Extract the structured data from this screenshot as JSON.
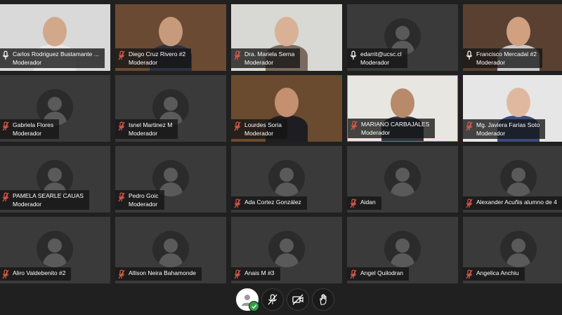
{
  "participants": [
    {
      "name": "Carlos Rodriguez Bustamante ...",
      "role": "Moderador",
      "mic": "on",
      "video": true,
      "bg": "#d9d9d9",
      "skin": "#d2a88a",
      "shirt": "#e8e8e8"
    },
    {
      "name": "Diego Cruz Rivero #2",
      "role": "Moderador",
      "mic": "muted",
      "video": true,
      "bg": "#6b4a33",
      "skin": "#c89a7c",
      "shirt": "#2d3140"
    },
    {
      "name": "Dra. Mariela Serna",
      "role": "Moderador",
      "mic": "muted",
      "video": true,
      "bg": "#d8d8d4",
      "skin": "#d9b196",
      "shirt": "#7b6a5f"
    },
    {
      "name": "edarrit@ucsc.cl",
      "role": "Moderador",
      "mic": "on",
      "video": false
    },
    {
      "name": "Francisco Mercadal #2",
      "role": "Moderador",
      "mic": "on",
      "video": true,
      "bg": "#5a4030",
      "skin": "#d0a080",
      "shirt": "#c9c9c9"
    },
    {
      "name": "Gabriela Flores",
      "role": "Moderador",
      "mic": "muted",
      "video": false
    },
    {
      "name": "Isnel Martinez M",
      "role": "Moderador",
      "mic": "muted",
      "video": false
    },
    {
      "name": "Lourdes Soria",
      "role": "Moderador",
      "mic": "muted",
      "video": true,
      "bg": "#6a4b2f",
      "skin": "#c49070",
      "shirt": "#1e1e22"
    },
    {
      "name": "MARIANO CARBAJALES",
      "role": "Moderador",
      "mic": "muted",
      "video": true,
      "bg": "#e8e6e0",
      "skin": "#b88a6a",
      "shirt": "#303440"
    },
    {
      "name": "Mg. Javiera Farías Soto",
      "role": "Moderador",
      "mic": "muted",
      "video": true,
      "bg": "#e6e6e6",
      "skin": "#e0b8a0",
      "shirt": "#3a4a7a"
    },
    {
      "name": "PAMELA SEARLE CAUAS",
      "role": "Moderador",
      "mic": "muted",
      "video": false
    },
    {
      "name": "Pedro Goic",
      "role": "Moderador",
      "mic": "muted",
      "video": false
    },
    {
      "name": "Ada Cortez González",
      "role": "",
      "mic": "muted",
      "video": false
    },
    {
      "name": "Aidan",
      "role": "",
      "mic": "muted",
      "video": false
    },
    {
      "name": "Alexander Acuñis alumno de 4",
      "role": "",
      "mic": "muted",
      "video": false
    },
    {
      "name": "Aliro Valdebenito #2",
      "role": "",
      "mic": "muted",
      "video": false
    },
    {
      "name": "Allison Neira Bahamonde",
      "role": "",
      "mic": "muted",
      "video": false
    },
    {
      "name": "Anais M #3",
      "role": "",
      "mic": "muted",
      "video": false
    },
    {
      "name": "Angel Quilodran",
      "role": "",
      "mic": "muted",
      "video": false
    },
    {
      "name": "Angelica Anchiu",
      "role": "",
      "mic": "muted",
      "video": false
    }
  ],
  "toolbar": {
    "buttons": [
      {
        "name": "user-status-button",
        "icon": "user-icon"
      },
      {
        "name": "mute-mic-button",
        "icon": "mic-off-icon"
      },
      {
        "name": "camera-off-button",
        "icon": "camera-off-icon"
      },
      {
        "name": "raise-hand-button",
        "icon": "hand-icon"
      }
    ]
  },
  "colors": {
    "muted_mic": "#e05a4a",
    "active_border": "#e05a4a",
    "status_ok": "#2ea043"
  },
  "active_speaker": "MARIANO CARBAJALES"
}
